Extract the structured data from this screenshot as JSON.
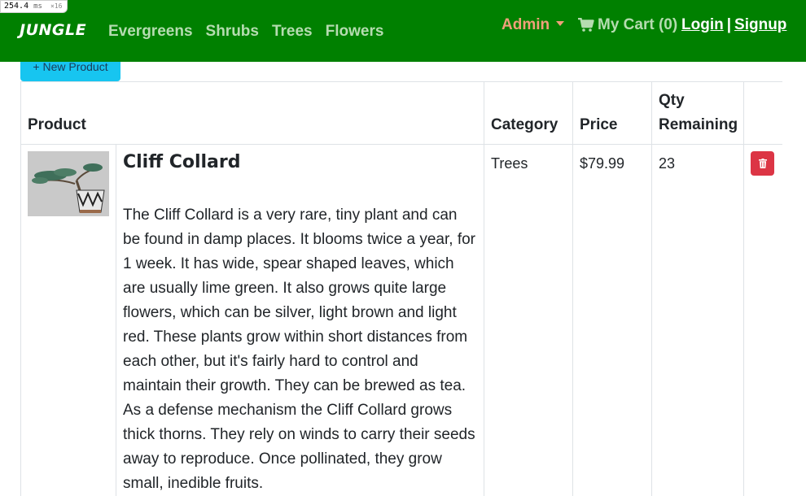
{
  "perf": {
    "value": "254.4",
    "unit": "ms",
    "multiplier": "×16"
  },
  "navbar": {
    "brand": "JUNGLE",
    "links": [
      "Evergreens",
      "Shrubs",
      "Trees",
      "Flowers"
    ],
    "admin_label": "Admin",
    "cart_label": "My Cart (0)",
    "login_label": "Login",
    "separator": "|",
    "signup_label": "Signup"
  },
  "new_product_label": "+ New Product",
  "table": {
    "headers": {
      "product": "Product",
      "category": "Category",
      "price": "Price",
      "qty_line1": "Qty",
      "qty_line2": "Remaining"
    },
    "rows": [
      {
        "name": "Cliff Collard",
        "description": "The Cliff Collard is a very rare, tiny plant and can be found in damp places. It blooms twice a year, for 1 week. It has wide, spear shaped leaves, which are usually lime green. It also grows quite large flowers, which can be silver, light brown and light red. These plants grow within short distances from each other, but it's fairly hard to control and maintain their growth. They can be brewed as tea. As a defense mechanism the Cliff Collard grows thick thorns. They rely on winds to carry their seeds away to reproduce. Once pollinated, they grow small, inedible fruits.",
        "category": "Trees",
        "price": "$79.99",
        "qty": "23",
        "delete_icon": "trash-icon"
      }
    ]
  },
  "colors": {
    "navbar_bg": "#008000",
    "nav_link": "#b5dcb0",
    "admin": "#f0a07a",
    "new_product_btn": "#17c5f0",
    "delete_btn": "#dc3545"
  }
}
